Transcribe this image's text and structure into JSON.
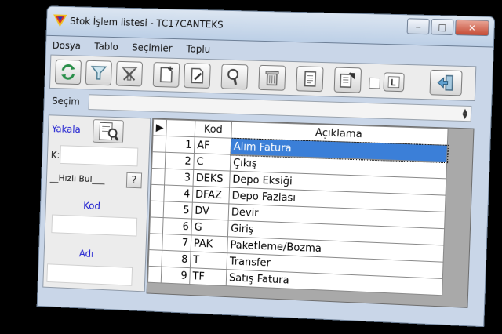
{
  "window": {
    "title": "Stok İşlem listesi - TC17CANTEKS",
    "controls": {
      "minimize": "‒",
      "maximize": "□",
      "close": "✕"
    }
  },
  "menu": [
    "Dosya",
    "Tablo",
    "Seçimler",
    "Toplu"
  ],
  "toolbar": {
    "icons": [
      "refresh-icon",
      "filter-icon",
      "clear-filter-icon",
      "new-document-icon",
      "edit-document-icon",
      "search-icon",
      "delete-icon",
      "copy-icon",
      "export-icon",
      "l-icon",
      "exit-icon"
    ]
  },
  "secim": {
    "label": "Seçim",
    "value": ""
  },
  "left_panel": {
    "yakala_label": "Yakala",
    "k_label": "K:",
    "hizli_bul_label": "__Hızlı Bul___",
    "help_label": "?",
    "kod_label": "Kod",
    "adi_label": "Adı"
  },
  "grid": {
    "columns": [
      "Kod",
      "Açıklama"
    ],
    "rows": [
      {
        "num": "1",
        "kod": "AF",
        "aciklama": "Alım Fatura"
      },
      {
        "num": "2",
        "kod": "C",
        "aciklama": "Çıkış"
      },
      {
        "num": "3",
        "kod": "DEKS",
        "aciklama": "Depo Eksiği"
      },
      {
        "num": "4",
        "kod": "DFAZ",
        "aciklama": "Depo Fazlası"
      },
      {
        "num": "5",
        "kod": "DV",
        "aciklama": "Devir"
      },
      {
        "num": "6",
        "kod": "G",
        "aciklama": "Giriş"
      },
      {
        "num": "7",
        "kod": "PAK",
        "aciklama": "Paketleme/Bozma"
      },
      {
        "num": "8",
        "kod": "T",
        "aciklama": "Transfer"
      },
      {
        "num": "9",
        "kod": "TF",
        "aciklama": "Satış Fatura"
      }
    ],
    "selected_row": 0
  },
  "colors": {
    "selection": "#3b7fd8",
    "link_blue": "#1a1ad0",
    "panel": "#c9d6e8"
  }
}
